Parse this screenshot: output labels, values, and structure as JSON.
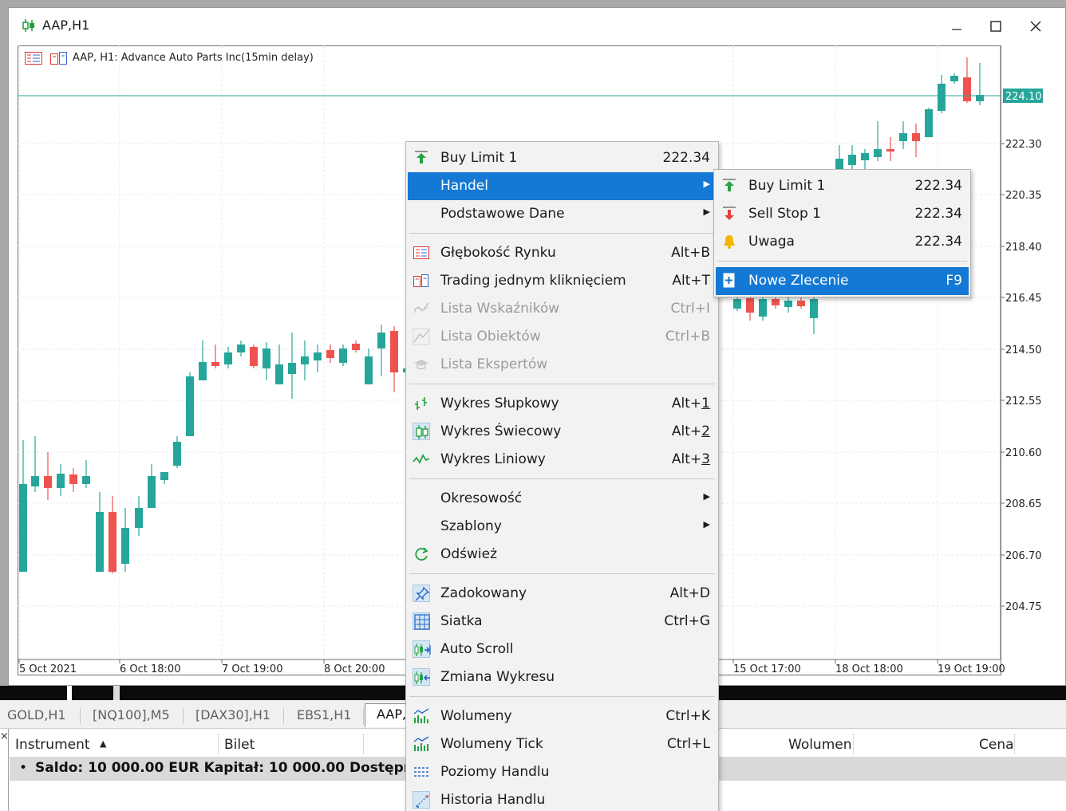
{
  "window": {
    "title": "AAP,H1"
  },
  "chart": {
    "symbol_info": "AAP, H1:  Advance Auto Parts Inc(15min delay)",
    "current_price": "224.10",
    "price_levels": [
      "222.30",
      "220.35",
      "218.40",
      "216.45",
      "214.50",
      "212.55",
      "210.60",
      "208.65",
      "206.70",
      "204.75"
    ],
    "time_labels": [
      "5 Oct 2021",
      "6 Oct 18:00",
      "7 Oct 19:00",
      "8 Oct 20:00",
      "15 Oct 17:00",
      "18 Oct 18:00",
      "19 Oct 19:00"
    ],
    "colors": {
      "bull": "#26a69a",
      "bear": "#ef5350",
      "price_line": "#26a69a"
    }
  },
  "context_menu": {
    "items": [
      {
        "label": "Buy Limit 1",
        "shortcut": "222.34",
        "icon": "buy-limit-icon"
      },
      {
        "label": "Handel",
        "icon": "",
        "submenu": true
      },
      {
        "label": "Podstawowe Dane",
        "icon": "",
        "submenu": true
      },
      {
        "label": "Głębokość Rynku",
        "shortcut": "Alt+B",
        "icon": "market-depth-icon"
      },
      {
        "label": "Trading jednym kliknięciem",
        "shortcut": "Alt+T",
        "icon": "one-click-trading-icon"
      },
      {
        "label": "Lista Wskaźników",
        "shortcut": "Ctrl+I",
        "icon": "indicators-icon"
      },
      {
        "label": "Lista Obiektów",
        "shortcut": "Ctrl+B",
        "icon": "objects-icon"
      },
      {
        "label": "Lista Ekspertów",
        "shortcut": "",
        "icon": "experts-icon"
      },
      {
        "label": "Wykres Słupkowy",
        "shortcut": "Alt+",
        "shortcut_key": "1",
        "icon": "bar-chart-icon"
      },
      {
        "label": "Wykres Świecowy",
        "shortcut": "Alt+",
        "shortcut_key": "2",
        "icon": "candle-chart-icon"
      },
      {
        "label": "Wykres Liniowy",
        "shortcut": "Alt+",
        "shortcut_key": "3",
        "icon": "line-chart-icon"
      },
      {
        "label": "Okresowość",
        "icon": "",
        "submenu": true
      },
      {
        "label": "Szablony",
        "icon": "",
        "submenu": true
      },
      {
        "label": "Odśwież",
        "icon": "refresh-icon"
      },
      {
        "label": "Zadokowany",
        "shortcut": "Alt+D",
        "icon": "pin-icon"
      },
      {
        "label": "Siatka",
        "shortcut": "Ctrl+G",
        "icon": "grid-icon"
      },
      {
        "label": "Auto Scroll",
        "shortcut": "",
        "icon": "auto-scroll-icon"
      },
      {
        "label": "Zmiana Wykresu",
        "shortcut": "",
        "icon": "chart-shift-icon"
      },
      {
        "label": "Wolumeny",
        "shortcut": "Ctrl+K",
        "icon": "volumes-icon"
      },
      {
        "label": "Wolumeny Tick",
        "shortcut": "Ctrl+L",
        "icon": "tick-volumes-icon"
      },
      {
        "label": "Poziomy Handlu",
        "shortcut": "",
        "icon": "trade-levels-icon"
      },
      {
        "label": "Historia Handlu",
        "shortcut": "",
        "icon": "trade-history-icon"
      }
    ]
  },
  "submenu": {
    "items": [
      {
        "label": "Buy Limit 1",
        "shortcut": "222.34",
        "icon": "buy-limit-icon"
      },
      {
        "label": "Sell Stop 1",
        "shortcut": "222.34",
        "icon": "sell-stop-icon"
      },
      {
        "label": "Uwaga",
        "shortcut": "222.34",
        "icon": "alert-bell-icon"
      },
      {
        "label": "Nowe Zlecenie",
        "shortcut": "F9",
        "icon": "new-order-icon"
      }
    ]
  },
  "tabs": [
    "GOLD,H1",
    "[NQ100],M5",
    "[DAX30],H1",
    "EBS1,H1",
    "AAP,"
  ],
  "table": {
    "close": "×",
    "headers": [
      "Instrument",
      "Bilet",
      "Wolumen",
      "Cena"
    ],
    "sort_indicator": "▲",
    "summary_bullet": "•",
    "summary": "Saldo: 10 000.00 EUR  Kapitał: 10 000.00  Dostępny Dep"
  }
}
